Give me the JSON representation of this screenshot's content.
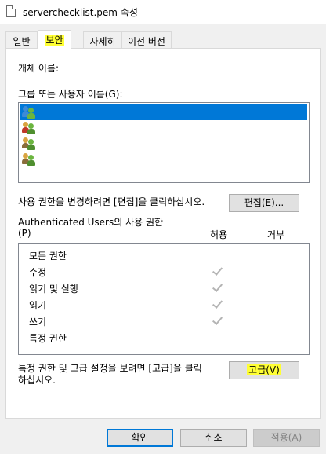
{
  "window": {
    "title": "serverchecklist.pem 속성"
  },
  "tabs": [
    {
      "label": "일반"
    },
    {
      "label": "보안"
    },
    {
      "label": "자세히"
    },
    {
      "label": "이전 버전"
    }
  ],
  "security": {
    "object_name_label": "개체 이름:",
    "group_label": "그룹 또는 사용자 이름(G):",
    "users": [
      {
        "name": "",
        "selected": true
      },
      {
        "name": "",
        "selected": false
      },
      {
        "name": "",
        "selected": false
      },
      {
        "name": "",
        "selected": false
      }
    ],
    "edit_hint": "사용 권한을 변경하려면 [편집]을 클릭하십시오.",
    "edit_button": "편집(E)...",
    "perm_header": "Authenticated Users의 사용 권한",
    "perm_header_p": "(P)",
    "col_allow": "허용",
    "col_deny": "거부",
    "permissions": [
      {
        "name": "모든 권한",
        "allow": false
      },
      {
        "name": "수정",
        "allow": true
      },
      {
        "name": "읽기 및 실행",
        "allow": true
      },
      {
        "name": "읽기",
        "allow": true
      },
      {
        "name": "쓰기",
        "allow": true
      },
      {
        "name": "특정 권한",
        "allow": false
      }
    ],
    "advanced_hint_1": "특정 권한 및 고급 설정을 보려면 [고급]을 클릭",
    "advanced_hint_2": "하십시오.",
    "advanced_button": "고급(V)"
  },
  "footer": {
    "ok": "확인",
    "cancel": "취소",
    "apply": "적용(A)"
  },
  "colors": {
    "selection": "#0078d7",
    "highlight": "#ffff33"
  }
}
